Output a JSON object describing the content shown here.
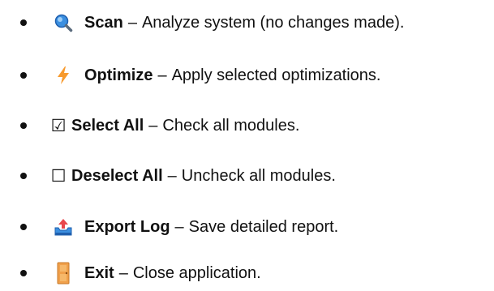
{
  "items": [
    {
      "icon": "magnifying-glass-icon",
      "name": "Scan",
      "separator": "–",
      "description": "Analyze system (no changes made)."
    },
    {
      "icon": "lightning-bolt-icon",
      "name": "Optimize",
      "separator": "–",
      "description": "Apply selected optimizations."
    },
    {
      "icon": "checked-box-icon",
      "icon_glyph": "☑",
      "name": "Select All",
      "separator": "–",
      "description": "Check all modules."
    },
    {
      "icon": "empty-box-icon",
      "icon_glyph": "☐",
      "name": "Deselect All",
      "separator": "–",
      "description": "Uncheck all modules."
    },
    {
      "icon": "outbox-tray-icon",
      "name": "Export Log",
      "separator": "–",
      "description": "Save detailed report."
    },
    {
      "icon": "door-icon",
      "name": "Exit",
      "separator": "–",
      "description": "Close application."
    }
  ]
}
